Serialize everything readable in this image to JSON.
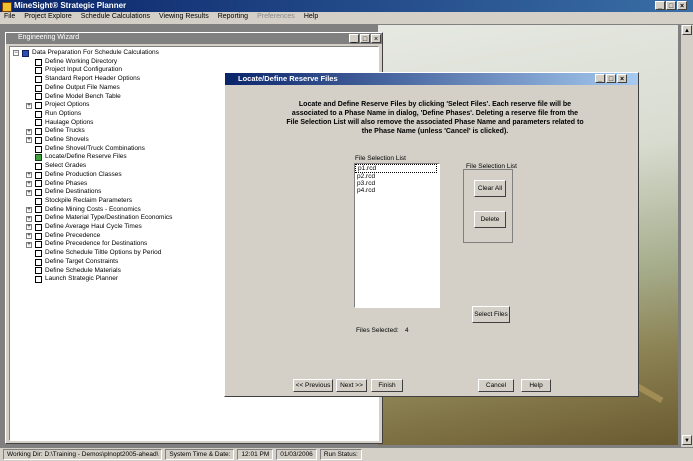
{
  "app": {
    "title": "MineSight® Strategic Planner"
  },
  "menu": [
    "File",
    "Project Explore",
    "Schedule Calculations",
    "Viewing Results",
    "Reporting",
    "Preferences",
    "Help"
  ],
  "tree_window": {
    "title": "Engineering Wizard",
    "items": [
      {
        "label": "Data Preparation For Schedule Calculations",
        "level": 0,
        "expander": "minus",
        "icon": "folder"
      },
      {
        "label": "Define Working Directory",
        "level": 1,
        "expander": "",
        "icon": "doc"
      },
      {
        "label": "Project Input Configuration",
        "level": 1,
        "expander": "",
        "icon": "doc"
      },
      {
        "label": "Standard Report Header Options",
        "level": 1,
        "expander": "",
        "icon": "doc"
      },
      {
        "label": "Define Output File Names",
        "level": 1,
        "expander": "",
        "icon": "doc"
      },
      {
        "label": "Define Model Bench Table",
        "level": 1,
        "expander": "",
        "icon": "doc"
      },
      {
        "label": "Project Options",
        "level": 1,
        "expander": "plus",
        "icon": "doc"
      },
      {
        "label": "Run Options",
        "level": 1,
        "expander": "",
        "icon": "doc"
      },
      {
        "label": "Haulage Options",
        "level": 1,
        "expander": "",
        "icon": "doc"
      },
      {
        "label": "Define Trucks",
        "level": 1,
        "expander": "plus",
        "icon": "doc"
      },
      {
        "label": "Define Shovels",
        "level": 1,
        "expander": "plus",
        "icon": "doc"
      },
      {
        "label": "Define Shovel/Truck Combinations",
        "level": 1,
        "expander": "",
        "icon": "doc"
      },
      {
        "label": "Locate/Define Reserve Files",
        "level": 1,
        "expander": "",
        "icon": "done"
      },
      {
        "label": "Select Grades",
        "level": 1,
        "expander": "",
        "icon": "doc"
      },
      {
        "label": "Define Production Classes",
        "level": 1,
        "expander": "plus",
        "icon": "doc"
      },
      {
        "label": "Define Phases",
        "level": 1,
        "expander": "plus",
        "icon": "doc"
      },
      {
        "label": "Define Destinations",
        "level": 1,
        "expander": "plus",
        "icon": "doc"
      },
      {
        "label": "Stockpile Reclaim Parameters",
        "level": 1,
        "expander": "",
        "icon": "doc"
      },
      {
        "label": "Define Mining Costs - Economics",
        "level": 1,
        "expander": "plus",
        "icon": "doc"
      },
      {
        "label": "Define Material Type/Destination Economics",
        "level": 1,
        "expander": "plus",
        "icon": "doc"
      },
      {
        "label": "Define Average Haul Cycle Times",
        "level": 1,
        "expander": "plus",
        "icon": "doc"
      },
      {
        "label": "Define Precedence",
        "level": 1,
        "expander": "plus",
        "icon": "doc"
      },
      {
        "label": "Define Precedence for Destinations",
        "level": 1,
        "expander": "plus",
        "icon": "doc"
      },
      {
        "label": "Define Schedule Tiltle Options by Period",
        "level": 1,
        "expander": "",
        "icon": "doc"
      },
      {
        "label": "Define Target Constraints",
        "level": 1,
        "expander": "",
        "icon": "doc"
      },
      {
        "label": "Define Schedule Materials",
        "level": 1,
        "expander": "",
        "icon": "doc"
      },
      {
        "label": "Launch Strategic Planner",
        "level": 1,
        "expander": "",
        "icon": "doc"
      }
    ]
  },
  "dialog": {
    "title": "Locate/Define Reserve Files",
    "instructions": "Locate and Define Reserve Files by clicking 'Select Files'.  Each reserve file will be associated to a Phase Name in dialog, 'Define Phases'.  Deleting a reserve file from the File Selection List will also remove the associated Phase Name and parameters related to the Phase Name (unless 'Cancel' is clicked).",
    "file_list_label": "File Selection List",
    "files": [
      "p1.rcd",
      "p2.rcd",
      "p3.rcd",
      "p4.rcd"
    ],
    "group_label": "File Selection List",
    "clear_all": "Clear All",
    "delete": "Delete",
    "select_files": "Select Files",
    "files_selected_label": "Files Selected:",
    "files_selected_count": "4",
    "prev": "<< Previous",
    "next": "Next >>",
    "finish": "Finish",
    "cancel": "Cancel",
    "help": "Help"
  },
  "status": {
    "working_dir": "Working Dir:  D:\\Training - Demos\\plnopt2005-ahead\\",
    "sys_time_label": "System Time & Date:",
    "time": "12:01 PM",
    "date": "01/03/2006",
    "run_status": "Run Status:"
  }
}
